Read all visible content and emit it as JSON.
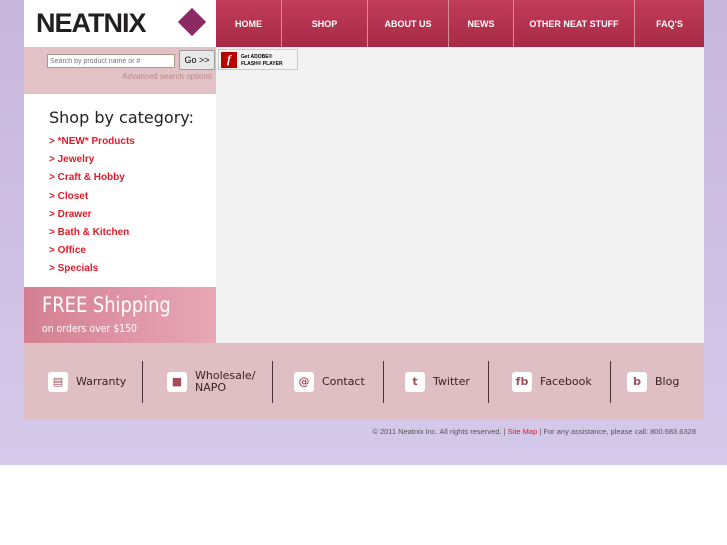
{
  "logo": "NEATNIX",
  "nav": [
    "HOME",
    "SHOP",
    "ABOUT US",
    "NEWS",
    "OTHER NEAT STUFF",
    "FAQ'S"
  ],
  "search": {
    "placeholder": "Search by product name or #",
    "go": "Go >>",
    "advanced": "Advanced search options"
  },
  "flash": {
    "line1": "Get ADOBE®",
    "line2": "FLASH® PLAYER"
  },
  "categories": {
    "title": "Shop by category:",
    "items": [
      "> *NEW* Products",
      "> Jewelry",
      "> Craft & Hobby",
      "> Closet",
      "> Drawer",
      "> Bath & Kitchen",
      "> Office",
      "> Specials"
    ]
  },
  "shipping": {
    "title": "FREE Shipping",
    "sub": "on orders over $150"
  },
  "footer_links": [
    {
      "label": "Warranty",
      "icon": "document-icon"
    },
    {
      "label": "Wholesale/ NAPO",
      "icon": "box-icon"
    },
    {
      "label": "Contact",
      "icon": "at-icon"
    },
    {
      "label": "Twitter",
      "icon": "twitter-icon"
    },
    {
      "label": "Facebook",
      "icon": "facebook-icon"
    },
    {
      "label": "Blog",
      "icon": "rss-icon"
    }
  ],
  "copyright": {
    "pre": "© 2011 Neatnix Inc. All rights reserved. |",
    "link": "Site Map",
    "post": "| For any assistance, please call: 800.683.6328"
  }
}
